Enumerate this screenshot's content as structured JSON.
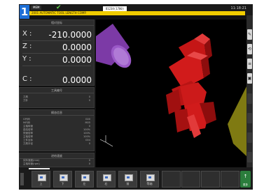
{
  "header": {
    "channel": "1",
    "mode_label": "MEM",
    "program_name": "O1234(1700)",
    "clock": "11:18:21",
    "alarm_text": "2001 AUTOMATIC TOOL LENGTH COMP."
  },
  "position": {
    "title": "相对坐标",
    "axes": [
      {
        "name": "X :",
        "value": "-210.0000"
      },
      {
        "name": "Z :",
        "value": "0.0000"
      },
      {
        "name": "Y :",
        "value": "0.0000"
      },
      {
        "name": "C :",
        "value": "0.0000"
      }
    ]
  },
  "tools": {
    "title": "工具编号",
    "rows": [
      {
        "label": "刀具",
        "value": "0"
      },
      {
        "label": "刀补",
        "value": "0"
      }
    ]
  },
  "modals": {
    "title": "模态信息",
    "rows": [
      {
        "label": "G代码",
        "value": "G00"
      },
      {
        "label": "M代码",
        "value": "M05"
      },
      {
        "label": "主轴转速",
        "value": "0"
      },
      {
        "label": "进给倍率",
        "value": "100%"
      },
      {
        "label": "快速倍率",
        "value": "100%"
      },
      {
        "label": "主轴倍率",
        "value": "100%"
      },
      {
        "label": "工件坐标",
        "value": "G54"
      },
      {
        "label": "刀具半径",
        "value": "0"
      }
    ]
  },
  "feed": {
    "title": "进给速度",
    "rows": [
      {
        "label": "实际速度(mm)",
        "value": "0"
      },
      {
        "label": "主轴转速(rpm)",
        "value": "0"
      }
    ]
  },
  "right_buttons": [
    "✎",
    "⟲",
    "≡",
    "▣",
    "",
    "",
    "",
    ""
  ],
  "bottom_buttons": [
    {
      "label": "上"
    },
    {
      "label": "下"
    },
    {
      "label": "左"
    },
    {
      "label": "右"
    },
    {
      "label": "前"
    },
    {
      "label": "等轴"
    },
    {
      "label": ""
    },
    {
      "label": ""
    },
    {
      "label": ""
    },
    {
      "label": ""
    }
  ],
  "bottom_right": {
    "icon": "↑",
    "label": "更多"
  },
  "colors": {
    "channel_blue": "#1d6fd6",
    "alarm_yellow": "#f0cc00",
    "part_red": "#d11b1b",
    "cylinder_purple": "#8a43b3",
    "chuck_olive": "#7f7a12",
    "status_green": "#5fd14d"
  }
}
